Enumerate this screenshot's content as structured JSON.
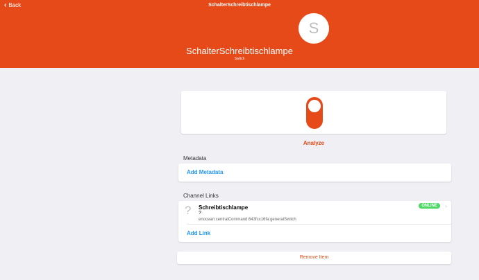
{
  "nav": {
    "back_label": "Back",
    "title": "SchalterSchreibtischlampe"
  },
  "thing": {
    "avatar_letter": "S",
    "name": "SchalterSchreibtischlampe",
    "type": "Switch"
  },
  "control": {
    "state": "on",
    "analyze_label": "Analyze"
  },
  "metadata": {
    "section_title": "Metadata",
    "add_label": "Add Metadata"
  },
  "channel_links": {
    "section_title": "Channel Links",
    "items": [
      {
        "icon": "question-icon",
        "title": "Schreibtischlampe",
        "subtitle": "?",
        "uid": "enocean:centralCommand:643fcc16fa:generalSwitch",
        "status": "ONLINE"
      }
    ],
    "add_label": "Add Link"
  },
  "remove_label": "Remove Item",
  "colors": {
    "accent": "#e64a19",
    "link": "#2196f3",
    "online": "#4cd964",
    "background": "#efeff4"
  }
}
